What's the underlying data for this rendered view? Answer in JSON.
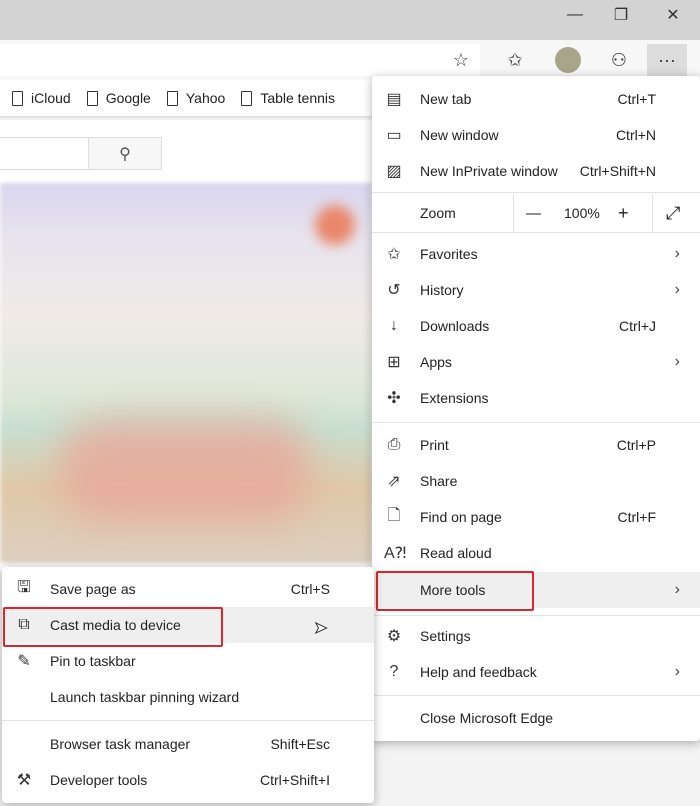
{
  "window": {
    "minimize": "—",
    "restore": "❐",
    "close": "✕"
  },
  "toolbar": {
    "icons": [
      "favorite-star-icon",
      "favorites-list-icon",
      "profile-avatar",
      "feedback-icon",
      "more-ellipsis-icon"
    ],
    "more": "···"
  },
  "bookmarks": [
    "iCloud",
    "Google",
    "Yahoo",
    "Table tennis"
  ],
  "main_menu": {
    "new_tab": {
      "label": "New tab",
      "shortcut": "Ctrl+T"
    },
    "new_window": {
      "label": "New window",
      "shortcut": "Ctrl+N"
    },
    "inprivate": {
      "label": "New InPrivate window",
      "shortcut": "Ctrl+Shift+N"
    },
    "zoom": {
      "label": "Zoom",
      "minus": "—",
      "value": "100%",
      "plus": "+",
      "fullscreen": "⤢"
    },
    "favorites": {
      "label": "Favorites"
    },
    "history": {
      "label": "History"
    },
    "downloads": {
      "label": "Downloads",
      "shortcut": "Ctrl+J"
    },
    "apps": {
      "label": "Apps"
    },
    "extensions": {
      "label": "Extensions"
    },
    "print": {
      "label": "Print",
      "shortcut": "Ctrl+P"
    },
    "share": {
      "label": "Share"
    },
    "find": {
      "label": "Find on page",
      "shortcut": "Ctrl+F"
    },
    "read_aloud": {
      "label": "Read aloud"
    },
    "more_tools": {
      "label": "More tools"
    },
    "settings": {
      "label": "Settings"
    },
    "help": {
      "label": "Help and feedback"
    },
    "close": {
      "label": "Close Microsoft Edge"
    }
  },
  "sub_menu": {
    "save": {
      "label": "Save page as",
      "shortcut": "Ctrl+S"
    },
    "cast": {
      "label": "Cast media to device"
    },
    "pin": {
      "label": "Pin to taskbar"
    },
    "wizard": {
      "label": "Launch taskbar pinning wizard"
    },
    "task_manager": {
      "label": "Browser task manager",
      "shortcut": "Shift+Esc"
    },
    "devtools": {
      "label": "Developer tools",
      "shortcut": "Ctrl+Shift+I"
    }
  },
  "colors": {
    "highlight_box": "#e0262a",
    "hover": "#efefef"
  }
}
